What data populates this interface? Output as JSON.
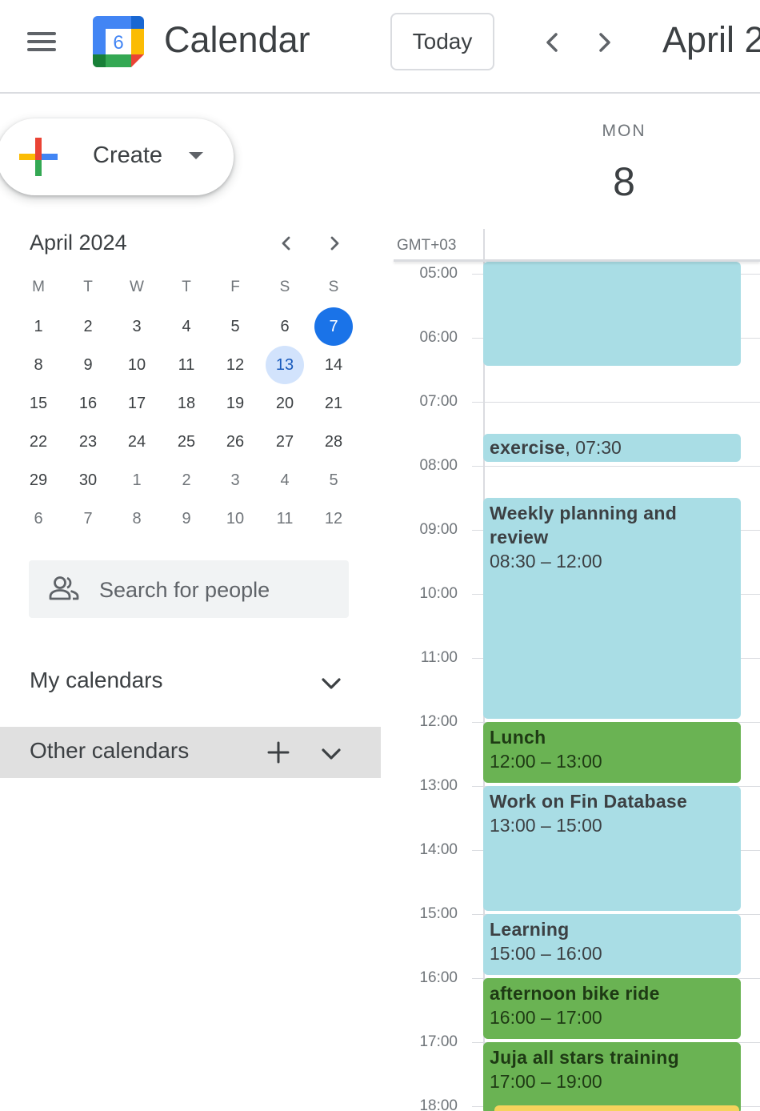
{
  "header": {
    "app_title": "Calendar",
    "logo_day": "6",
    "today_label": "Today",
    "month_title": "April 2"
  },
  "create": {
    "label": "Create"
  },
  "mini_calendar": {
    "title": "April 2024",
    "weekdays": [
      "M",
      "T",
      "W",
      "T",
      "F",
      "S",
      "S"
    ],
    "weeks": [
      [
        "1",
        "2",
        "3",
        "4",
        "5",
        "6",
        "7"
      ],
      [
        "8",
        "9",
        "10",
        "11",
        "12",
        "13",
        "14"
      ],
      [
        "15",
        "16",
        "17",
        "18",
        "19",
        "20",
        "21"
      ],
      [
        "22",
        "23",
        "24",
        "25",
        "26",
        "27",
        "28"
      ],
      [
        "29",
        "30",
        "1",
        "2",
        "3",
        "4",
        "5"
      ],
      [
        "6",
        "7",
        "8",
        "9",
        "10",
        "11",
        "12"
      ]
    ],
    "today": "7",
    "selected": "13"
  },
  "search_people": {
    "placeholder": "Search for people"
  },
  "sections": {
    "my_calendars": "My calendars",
    "other_calendars": "Other calendars"
  },
  "day_view": {
    "day_name": "MON",
    "day_number": "8",
    "timezone": "GMT+03",
    "hours": [
      "05:00",
      "06:00",
      "07:00",
      "08:00",
      "09:00",
      "10:00",
      "11:00",
      "12:00",
      "13:00",
      "14:00",
      "15:00",
      "16:00",
      "17:00",
      "18:00"
    ]
  },
  "events": [
    {
      "title": "",
      "time": ""
    },
    {
      "title": "exercise",
      "time": ", 07:30"
    },
    {
      "title": "Weekly planning and review",
      "time": "08:30 – 12:00"
    },
    {
      "title": "Lunch",
      "time": "12:00 – 13:00"
    },
    {
      "title": "Work on Fin Database",
      "time": "13:00 – 15:00"
    },
    {
      "title": "Learning",
      "time": "15:00 – 16:00"
    },
    {
      "title": "afternoon bike ride",
      "time": "16:00 – 17:00"
    },
    {
      "title": "Juja all stars training",
      "time": "17:00 – 19:00"
    },
    {
      "title": "",
      "time": ""
    }
  ],
  "colors": {
    "event_blue": "#a9dde5",
    "event_green": "#6ab353",
    "event_yellow": "#f6d35c",
    "today_blue": "#1a73e8",
    "selected_light_blue": "#d2e3fc"
  },
  "icons": [
    "menu-icon",
    "calendar-logo-icon",
    "chevron-left-icon",
    "chevron-right-icon",
    "plus-multicolor-icon",
    "caret-down-icon",
    "people-icon",
    "chevron-down-icon",
    "plus-icon"
  ]
}
